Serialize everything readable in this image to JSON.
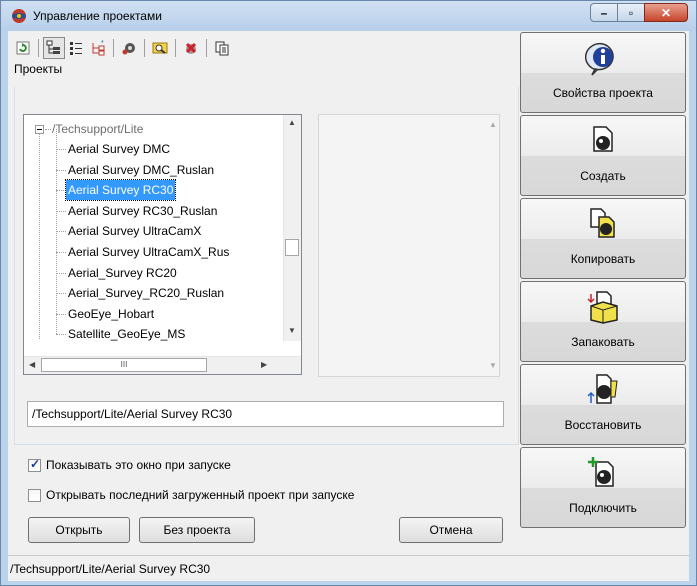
{
  "window": {
    "title": "Управление проектами"
  },
  "toolbar": {
    "buttons": [
      {
        "icon": "refresh-icon"
      },
      {
        "icon": "tree-view-icon",
        "pressed": true
      },
      {
        "icon": "list-view-icon"
      },
      {
        "icon": "new-folder-icon"
      },
      {
        "icon": "settings-icon"
      },
      {
        "icon": "find-icon"
      },
      {
        "icon": "delete-icon"
      },
      {
        "icon": "copy-path-icon"
      }
    ]
  },
  "projects": {
    "group_label": "Проекты",
    "root": "/Techsupport/Lite",
    "items": [
      "Aerial Survey DMC",
      "Aerial Survey DMC_Ruslan",
      "Aerial Survey RC30",
      "Aerial Survey RC30_Ruslan",
      "Aerial Survey UltraCamX",
      "Aerial Survey UltraCamX_Rus",
      "Aerial_Survey RC20",
      "Aerial_Survey_RC20_Ruslan",
      "GeoEye_Hobart",
      "Satellite_GeoEye_MS"
    ],
    "selected": "Aerial Survey RC30",
    "hscroll_marker": "III"
  },
  "path_field": {
    "value": "/Techsupport/Lite/Aerial Survey RC30"
  },
  "options": {
    "show_on_start": {
      "label": "Показывать это окно при запуске",
      "checked": true
    },
    "open_last": {
      "label": "Открывать последний загруженный проект при запуске",
      "checked": false
    }
  },
  "buttons": {
    "open": "Открыть",
    "no_project": "Без проекта",
    "cancel": "Отмена"
  },
  "side_buttons": [
    {
      "label": "Свойства проекта",
      "icon": "info-icon"
    },
    {
      "label": "Создать",
      "icon": "create-project-icon"
    },
    {
      "label": "Копировать",
      "icon": "copy-project-icon"
    },
    {
      "label": "Запаковать",
      "icon": "pack-project-icon"
    },
    {
      "label": "Восстановить",
      "icon": "restore-project-icon"
    },
    {
      "label": "Подключить",
      "icon": "connect-project-icon"
    }
  ],
  "status": {
    "text": "/Techsupport/Lite/Aerial Survey RC30"
  }
}
